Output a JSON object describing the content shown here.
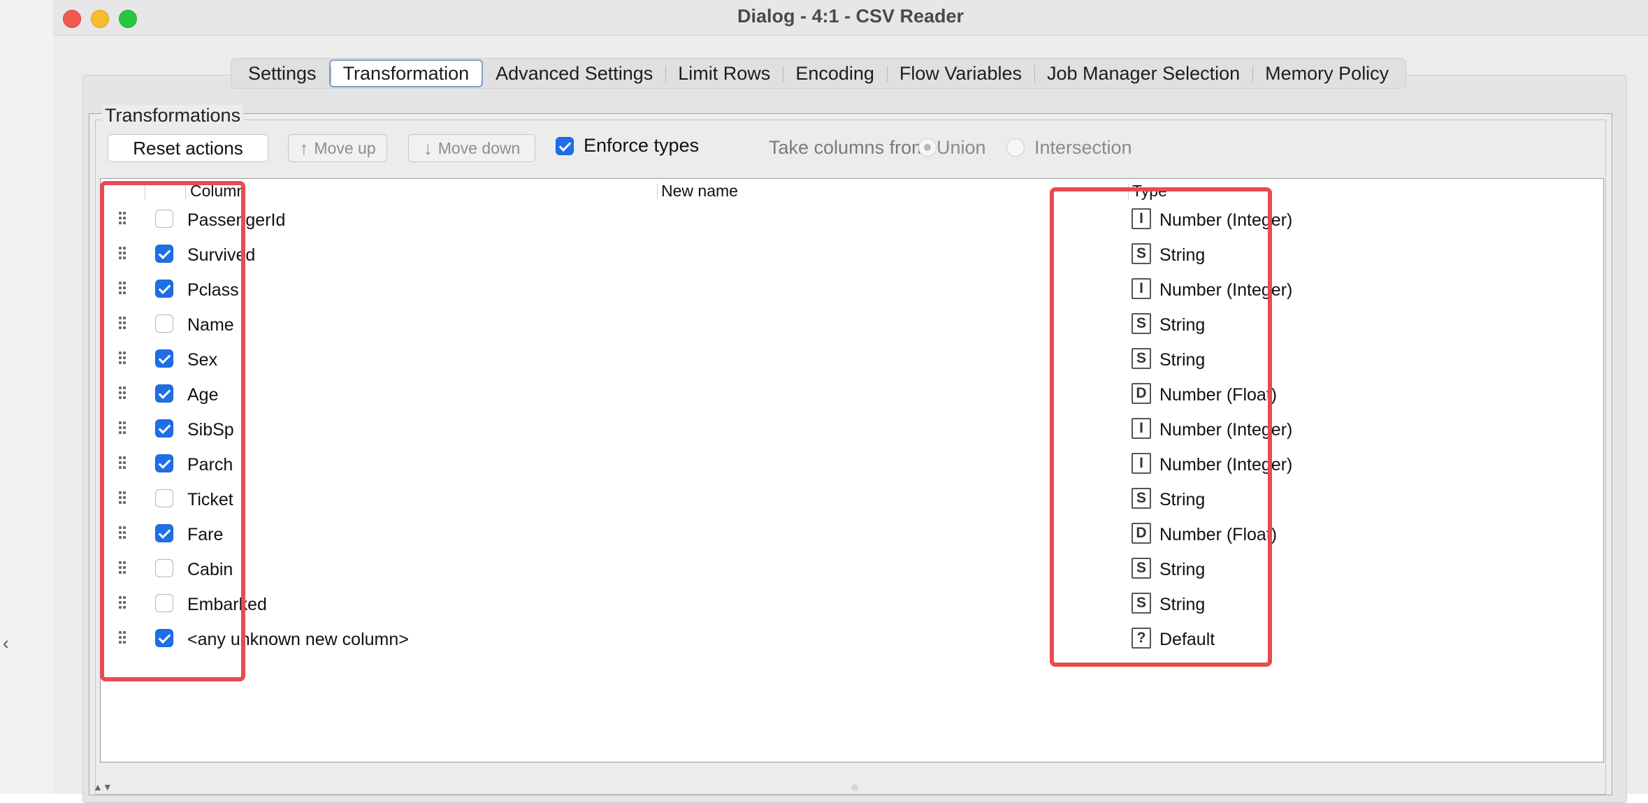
{
  "window": {
    "title": "Dialog - 4:1 - CSV Reader"
  },
  "tabs": [
    {
      "label": "Settings",
      "active": false
    },
    {
      "label": "Transformation",
      "active": true
    },
    {
      "label": "Advanced Settings",
      "active": false
    },
    {
      "label": "Limit Rows",
      "active": false
    },
    {
      "label": "Encoding",
      "active": false
    },
    {
      "label": "Flow Variables",
      "active": false
    },
    {
      "label": "Job Manager Selection",
      "active": false
    },
    {
      "label": "Memory Policy",
      "active": false
    }
  ],
  "transformations": {
    "group_title": "Transformations",
    "reset_label": "Reset actions",
    "move_up_label": "Move up",
    "move_down_label": "Move down",
    "enforce_types_label": "Enforce types",
    "enforce_types_checked": true,
    "take_columns_from_label": "Take columns from:",
    "union_label": "Union",
    "intersection_label": "Intersection",
    "selected_option": "Union"
  },
  "table": {
    "headers": {
      "column": "Column",
      "new_name": "New name",
      "type": "Type"
    },
    "rows": [
      {
        "checked": false,
        "column": "PassengerId",
        "new_name": "",
        "type_badge": "I",
        "type": "Number (Integer)"
      },
      {
        "checked": true,
        "column": "Survived",
        "new_name": "",
        "type_badge": "S",
        "type": "String"
      },
      {
        "checked": true,
        "column": "Pclass",
        "new_name": "",
        "type_badge": "I",
        "type": "Number (Integer)"
      },
      {
        "checked": false,
        "column": "Name",
        "new_name": "",
        "type_badge": "S",
        "type": "String"
      },
      {
        "checked": true,
        "column": "Sex",
        "new_name": "",
        "type_badge": "S",
        "type": "String"
      },
      {
        "checked": true,
        "column": "Age",
        "new_name": "",
        "type_badge": "D",
        "type": "Number (Float)"
      },
      {
        "checked": true,
        "column": "SibSp",
        "new_name": "",
        "type_badge": "I",
        "type": "Number (Integer)"
      },
      {
        "checked": true,
        "column": "Parch",
        "new_name": "",
        "type_badge": "I",
        "type": "Number (Integer)"
      },
      {
        "checked": false,
        "column": "Ticket",
        "new_name": "",
        "type_badge": "S",
        "type": "String"
      },
      {
        "checked": true,
        "column": "Fare",
        "new_name": "",
        "type_badge": "D",
        "type": "Number (Float)"
      },
      {
        "checked": false,
        "column": "Cabin",
        "new_name": "",
        "type_badge": "S",
        "type": "String"
      },
      {
        "checked": false,
        "column": "Embarked",
        "new_name": "",
        "type_badge": "S",
        "type": "String"
      },
      {
        "checked": true,
        "column": "<any unknown new column>",
        "new_name": "",
        "type_badge": "?",
        "type": "Default"
      }
    ]
  },
  "colors": {
    "accent": "#1e6ee8",
    "highlight": "#e84a4f"
  }
}
